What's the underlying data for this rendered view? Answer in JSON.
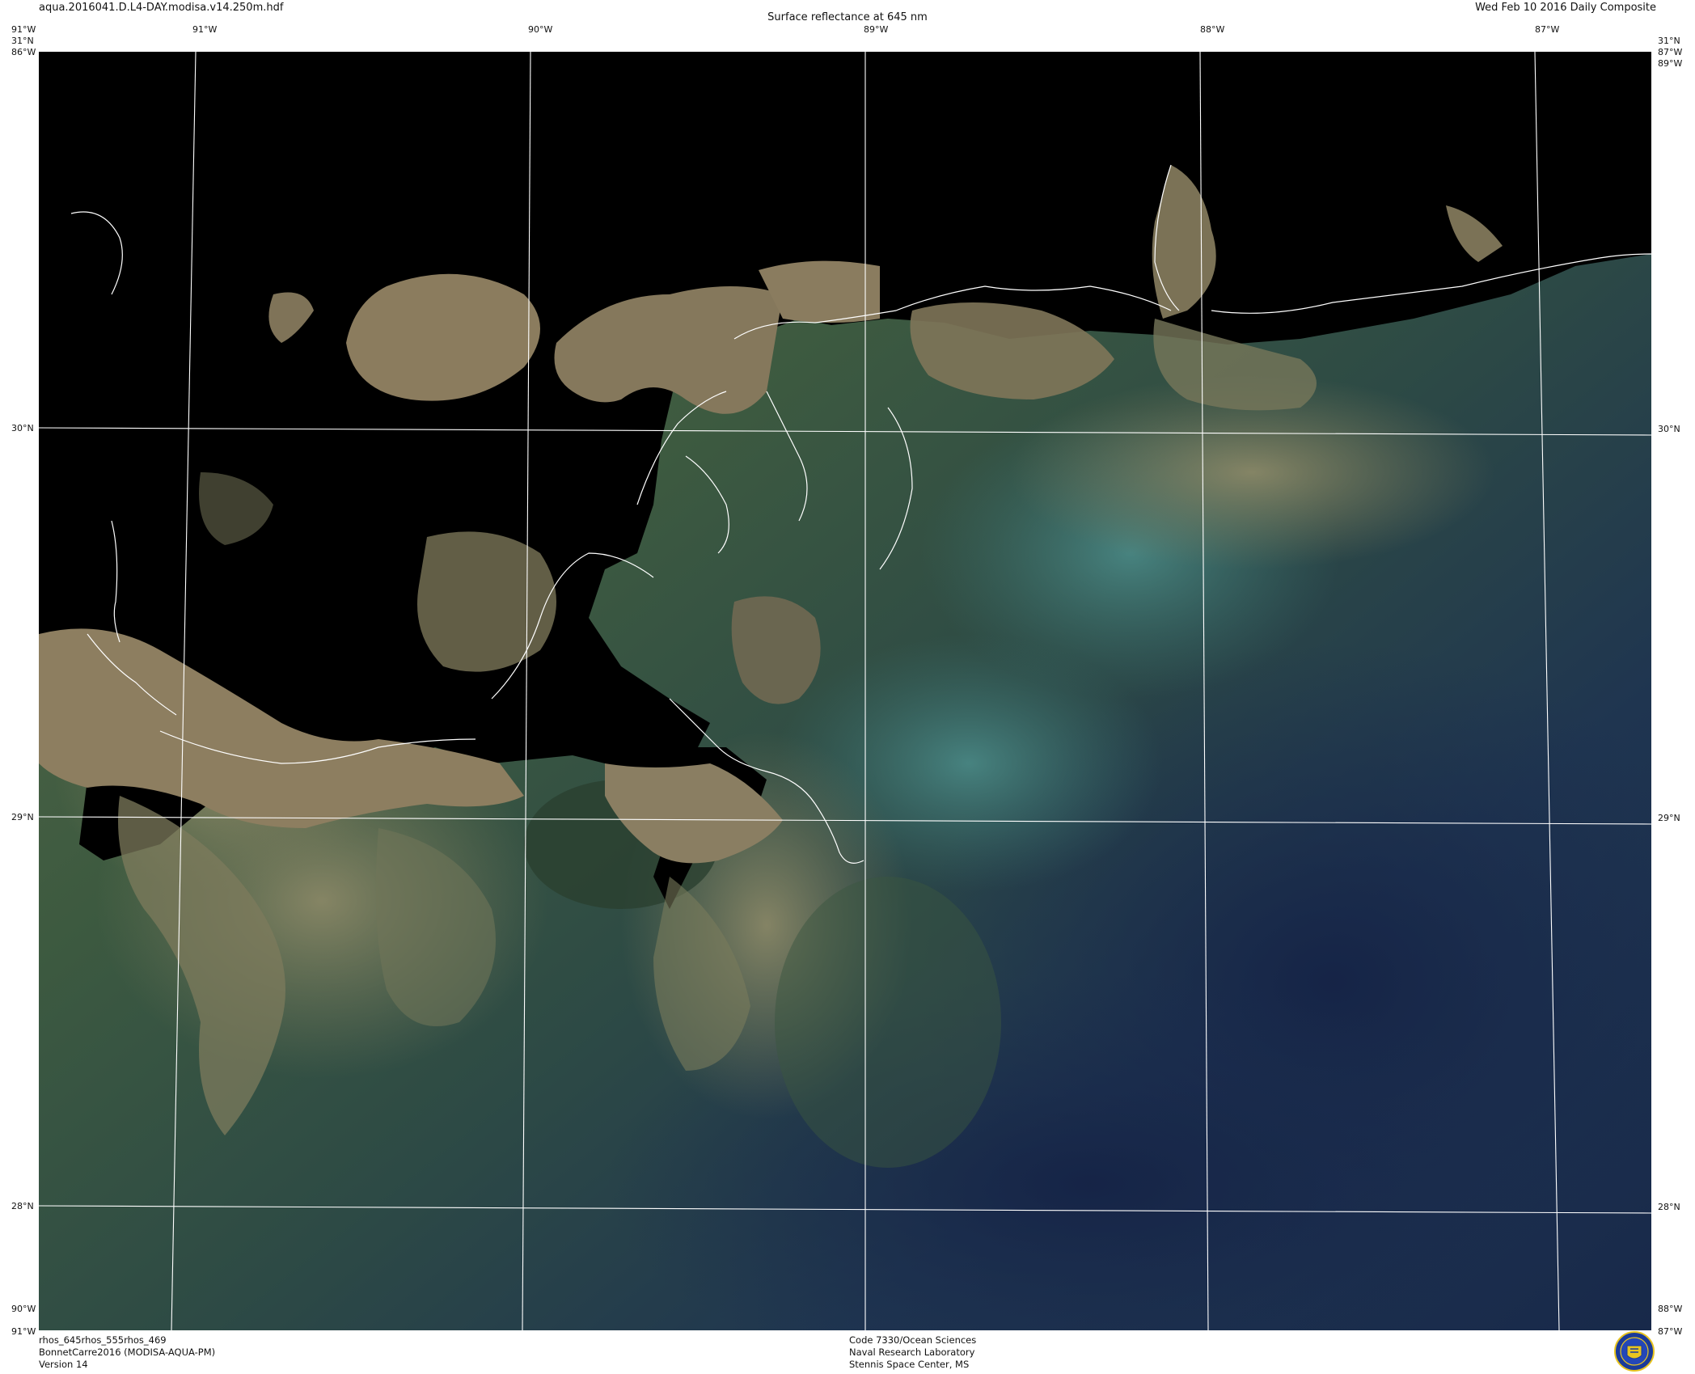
{
  "header": {
    "filename": "aqua.2016041.D.L4-DAY.modisa.v14.250m.hdf",
    "title": "Surface reflectance at 645 nm",
    "date": "Wed Feb 10 2016 Daily Composite"
  },
  "axes": {
    "top": [
      {
        "label": "91°W"
      },
      {
        "label": "90°W"
      },
      {
        "label": "89°W"
      },
      {
        "label": "88°W"
      },
      {
        "label": "87°W"
      }
    ],
    "left": [
      {
        "label": "30°N"
      },
      {
        "label": "29°N"
      },
      {
        "label": "28°N"
      }
    ],
    "right": [
      {
        "label": "30°N"
      },
      {
        "label": "29°N"
      },
      {
        "label": "28°N"
      }
    ],
    "corners": {
      "top_left_lat": "31°N",
      "top_left_lon": "91°W",
      "top_right_lat": "31°N",
      "top_right_lon": "87°W",
      "bottom_left_lon": "91°W",
      "bottom_right_lon": "87°W",
      "bottom_left_inner": "90°W",
      "bottom_right_inner": "88°W",
      "top_left_inner": "86°W",
      "top_right_inner": "89°W"
    }
  },
  "footer": {
    "left": [
      "rhos_645rhos_555rhos_469",
      "BonnetCarre2016 (MODISA-AQUA-PM)",
      "Version 14"
    ],
    "center": [
      "Code 7330/Ocean Sciences",
      "Naval Research Laboratory",
      "Stennis Space Center, MS"
    ]
  },
  "colors": {
    "land": "#000000",
    "sediment": "#8a7d62",
    "turbid_green": "#3e5a3c",
    "teal": "#3f7f80",
    "deep_water": "#1d2c4c",
    "gridline": "#ffffff",
    "coastline": "#ffffff"
  },
  "logo": {
    "icon": "nrl-seal-icon"
  }
}
